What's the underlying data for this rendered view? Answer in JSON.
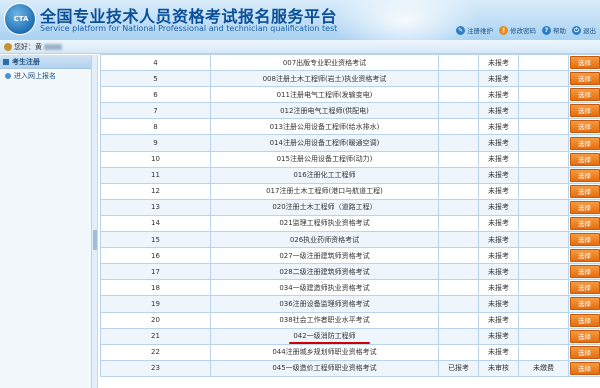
{
  "header": {
    "title_cn": "全国专业技术人员资格考试报名服务平台",
    "title_en": "Service platform for National Professional and technician qualification test",
    "logo_text": "CTA",
    "tools": [
      {
        "icon": "user-edit-icon",
        "label": "注册维护"
      },
      {
        "icon": "key-icon",
        "label": "修改密码"
      },
      {
        "icon": "help-icon",
        "label": "帮助"
      },
      {
        "icon": "logout-icon",
        "label": "退出"
      }
    ]
  },
  "subbar": {
    "welcome": "您好：黄"
  },
  "sidebar": {
    "title": "考生注册",
    "items": [
      {
        "label": "进入网上报名"
      }
    ]
  },
  "table": {
    "rows": [
      {
        "num": "4",
        "exam": "007出版专业职业资格考试",
        "c3": "",
        "c4": "未报考",
        "c5": "",
        "button": "选择"
      },
      {
        "num": "5",
        "exam": "008注册土木工程师(岩土)执业资格考试",
        "c3": "",
        "c4": "未报考",
        "c5": "",
        "button": "选择"
      },
      {
        "num": "6",
        "exam": "011注册电气工程师(发输变电)",
        "c3": "",
        "c4": "未报考",
        "c5": "",
        "button": "选择"
      },
      {
        "num": "7",
        "exam": "012注册电气工程师(供配电)",
        "c3": "",
        "c4": "未报考",
        "c5": "",
        "button": "选择"
      },
      {
        "num": "8",
        "exam": "013注册公用设备工程师(给水排水)",
        "c3": "",
        "c4": "未报考",
        "c5": "",
        "button": "选择"
      },
      {
        "num": "9",
        "exam": "014注册公用设备工程师(暖通空调)",
        "c3": "",
        "c4": "未报考",
        "c5": "",
        "button": "选择"
      },
      {
        "num": "10",
        "exam": "015注册公用设备工程师(动力)",
        "c3": "",
        "c4": "未报考",
        "c5": "",
        "button": "选择"
      },
      {
        "num": "11",
        "exam": "016注册化工工程师",
        "c3": "",
        "c4": "未报考",
        "c5": "",
        "button": "选择"
      },
      {
        "num": "12",
        "exam": "017注册土木工程师(港口与航道工程)",
        "c3": "",
        "c4": "未报考",
        "c5": "",
        "button": "选择"
      },
      {
        "num": "13",
        "exam": "020注册土木工程师（道路工程）",
        "c3": "",
        "c4": "未报考",
        "c5": "",
        "button": "选择"
      },
      {
        "num": "14",
        "exam": "021监理工程师执业资格考试",
        "c3": "",
        "c4": "未报考",
        "c5": "",
        "button": "选择"
      },
      {
        "num": "15",
        "exam": "026执业药师资格考试",
        "c3": "",
        "c4": "未报考",
        "c5": "",
        "button": "选择"
      },
      {
        "num": "16",
        "exam": "027一级注册建筑师资格考试",
        "c3": "",
        "c4": "未报考",
        "c5": "",
        "button": "选择"
      },
      {
        "num": "17",
        "exam": "028二级注册建筑师资格考试",
        "c3": "",
        "c4": "未报考",
        "c5": "",
        "button": "选择"
      },
      {
        "num": "18",
        "exam": "034一级建造师执业资格考试",
        "c3": "",
        "c4": "未报考",
        "c5": "",
        "button": "选择"
      },
      {
        "num": "19",
        "exam": "036注册设备监理师资格考试",
        "c3": "",
        "c4": "未报考",
        "c5": "",
        "button": "选择"
      },
      {
        "num": "20",
        "exam": "038社会工作者职业水平考试",
        "c3": "",
        "c4": "未报考",
        "c5": "",
        "button": "选择"
      },
      {
        "num": "21",
        "exam": "042一级消防工程师",
        "c3": "",
        "c4": "未报考",
        "c5": "",
        "button": "选择",
        "highlight": true
      },
      {
        "num": "22",
        "exam": "044注册城乡规划师职业资格考试",
        "c3": "",
        "c4": "未报考",
        "c5": "",
        "button": "选择"
      },
      {
        "num": "23",
        "exam": "045一级造价工程师职业资格考试",
        "c3": "已报考",
        "c4": "未审核",
        "c5": "未缴费",
        "button": "选择"
      }
    ]
  }
}
